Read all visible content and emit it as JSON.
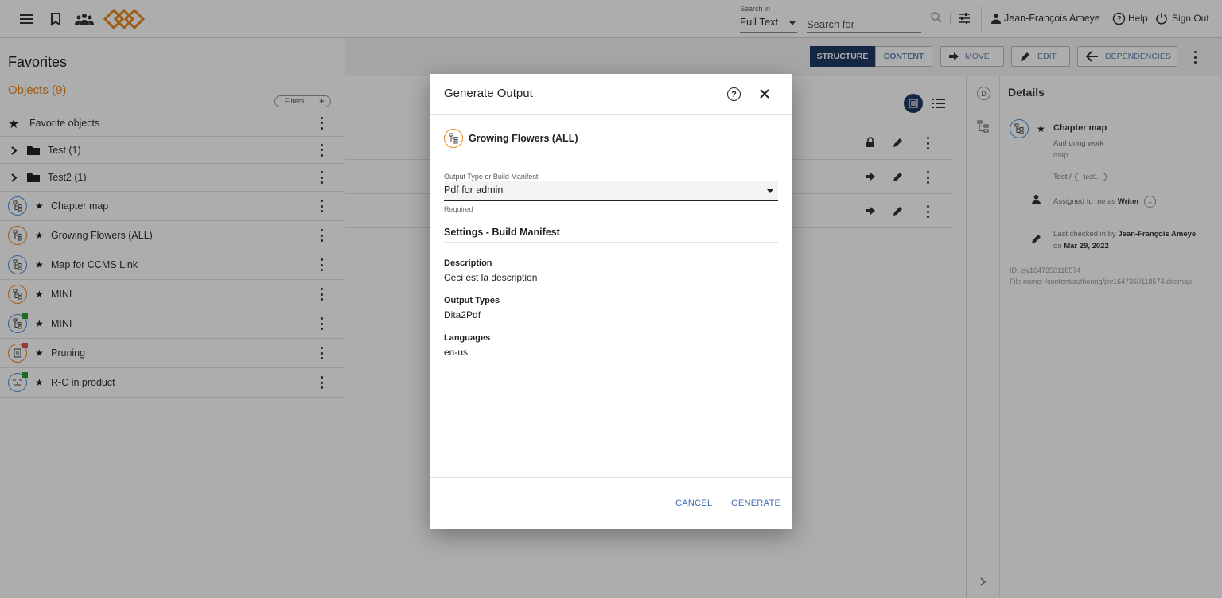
{
  "topbar": {
    "search_in_label": "Search in",
    "search_in_value": "Full Text",
    "search_placeholder": "Search for",
    "user_name": "Jean-François Ameye",
    "help_label": "Help",
    "signout_label": "Sign Out"
  },
  "left": {
    "title": "Favorites",
    "objects_title": "Objects (9)",
    "filters_label": "Filters",
    "favorite_objects_label": "Favorite objects",
    "folders": [
      {
        "label": "Test (1)"
      },
      {
        "label": "Test2 (1)"
      }
    ],
    "items": [
      {
        "label": "Chapter map",
        "icon": "map-icon",
        "color": "blue"
      },
      {
        "label": "Growing Flowers (ALL)",
        "icon": "map-icon",
        "color": "orange"
      },
      {
        "label": "Map for CCMS Link",
        "icon": "map-icon",
        "color": "blue"
      },
      {
        "label": "MINI",
        "icon": "map-icon",
        "color": "orange"
      },
      {
        "label": "MINI",
        "icon": "map-icon",
        "color": "blue"
      },
      {
        "label": "Pruning",
        "icon": "topic-icon",
        "color": "orange"
      },
      {
        "label": "R-C in product",
        "icon": "relationship-icon",
        "color": "blue"
      }
    ]
  },
  "toolbar": {
    "structure_label": "STRUCTURE",
    "content_label": "CONTENT",
    "move_label": "MOVE",
    "edit_label": "EDIT",
    "dependencies_label": "DEPENDENCIES"
  },
  "details": {
    "title": "Details",
    "object_title": "Chapter map",
    "status": "Authoring work",
    "type": "map",
    "folder_prefix": "Test /",
    "folder_chip": "test1",
    "assigned_text": "Assigned to me as",
    "assigned_role": "Writer",
    "checked_in_text": "Last checked in by",
    "checked_in_user": "Jean-François Ameye",
    "checked_in_on": "on",
    "checked_in_date": "Mar 29, 2022",
    "id_text": "ID: jsy1647350118574",
    "file_text": "File name: /content/authoring/jsy1647350118574.ditamap"
  },
  "dialog": {
    "title": "Generate Output",
    "object_name": "Growing Flowers (ALL)",
    "output_type_label": "Output Type or Build Manifest",
    "output_type_value": "Pdf for admin",
    "required_text": "Required",
    "section_title": "Settings - Build Manifest",
    "description_label": "Description",
    "description_value": "Ceci est la description",
    "output_types_label": "Output Types",
    "output_types_value": "Dita2Pdf",
    "languages_label": "Languages",
    "languages_value": "en-us",
    "cancel_label": "CANCEL",
    "generate_label": "GENERATE"
  },
  "colors": {
    "accent_orange": "#e8891f",
    "accent_blue": "#3f6cae",
    "structure_btn": "#1f3a63"
  }
}
